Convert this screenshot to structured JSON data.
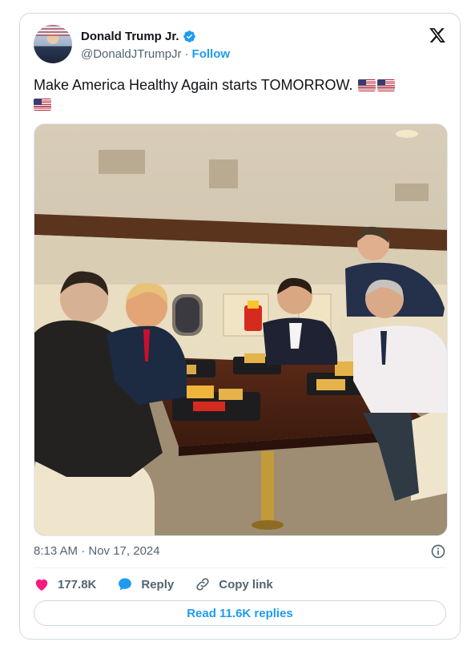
{
  "author": {
    "name": "Donald Trump Jr.",
    "handle": "@DonaldJTrumpJr",
    "separator": "·",
    "follow_label": "Follow"
  },
  "icons": {
    "verified": "verified-badge-icon",
    "x_logo": "x-logo-icon",
    "info": "info-icon",
    "like": "heart-icon",
    "reply": "speech-bubble-icon",
    "copy_link": "link-icon"
  },
  "tweet": {
    "text": "Make America Healthy Again starts TOMORROW.",
    "emojis": [
      "us-flag",
      "us-flag",
      "us-flag"
    ],
    "image_alt": "Group of men seated around a table on a private jet eating McDonald's food"
  },
  "meta": {
    "timestamp": "8:13 AM · Nov 17, 2024"
  },
  "actions": {
    "like_count": "177.8K",
    "reply_label": "Reply",
    "copy_link_label": "Copy link"
  },
  "footer": {
    "read_replies_label": "Read 11.6K replies"
  },
  "colors": {
    "accent": "#1d9bf0",
    "like": "#f91880",
    "secondary_text": "#536471",
    "border": "#cfd9de"
  }
}
